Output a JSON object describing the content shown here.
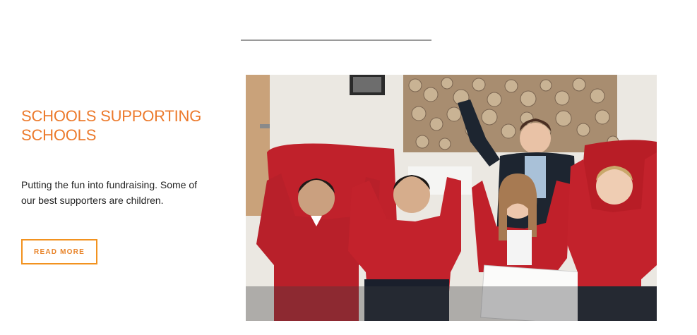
{
  "section": {
    "title": "SCHOOLS SUPPORTING SCHOOLS",
    "description": "Putting the fun into fundraising. Some of our best supporters are children.",
    "button_label": "READ MORE",
    "image_alt": "Schoolchildren in red jumpers with arms raised, sitting with a smiling woman"
  },
  "colors": {
    "heading": "#ec7a2c",
    "button_border": "#f2921f",
    "divider": "#9a9a9a",
    "text": "#222222"
  }
}
